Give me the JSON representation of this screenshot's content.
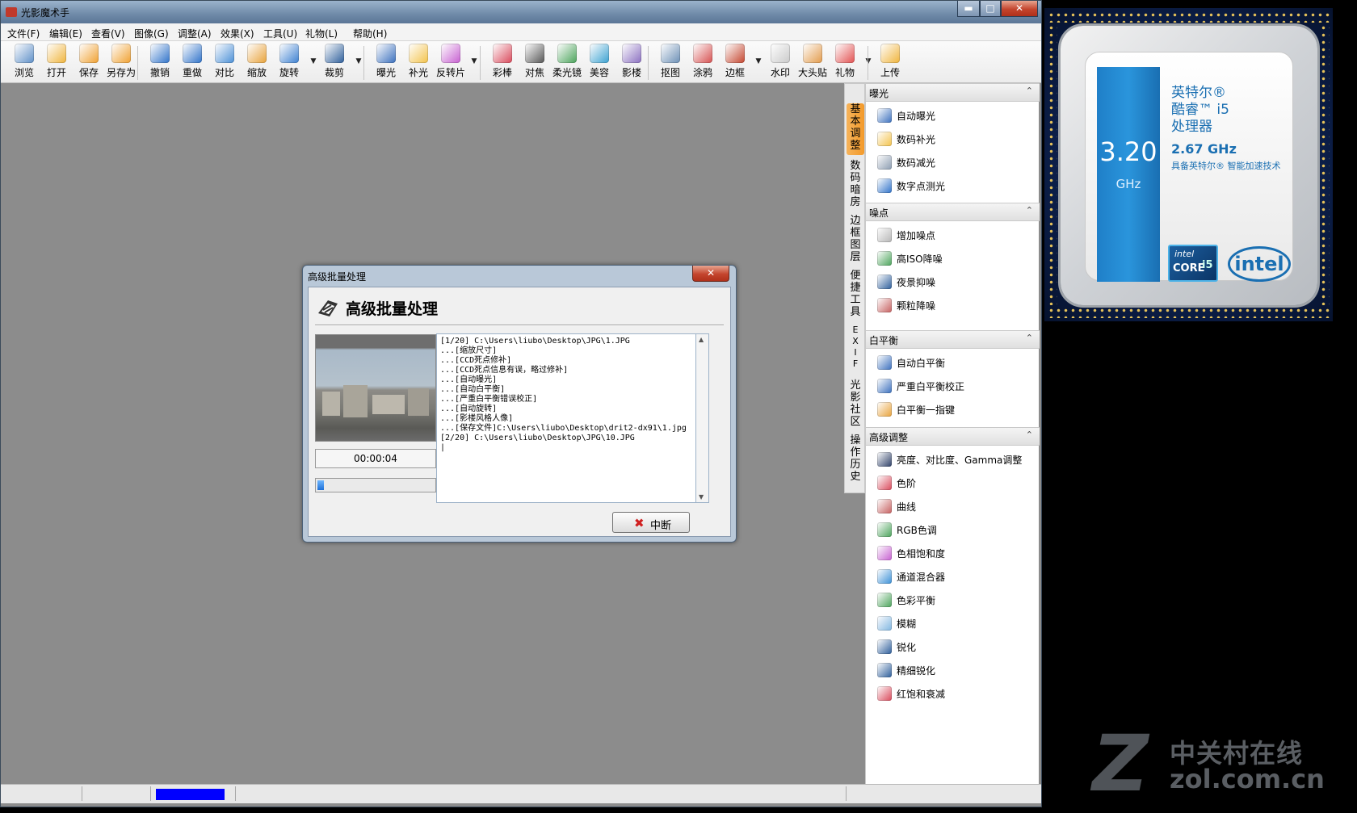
{
  "window": {
    "title": "光影魔术手",
    "caption_buttons": {
      "minimize": "▬",
      "maximize": "□",
      "close": "✕"
    }
  },
  "menu": [
    "文件(F)",
    "编辑(E)",
    "查看(V)",
    "图像(G)",
    "调整(A)",
    "效果(X)",
    "工具(U)",
    "礼物(L)",
    "帮助(H)"
  ],
  "toolbar": [
    {
      "label": "浏览",
      "icon": "browse-icon",
      "color": "#5d8fc7"
    },
    {
      "label": "打开",
      "icon": "open-folder-icon",
      "color": "#f0b43c"
    },
    {
      "label": "保存",
      "icon": "save-icon",
      "color": "#f0a030"
    },
    {
      "label": "另存为",
      "icon": "save-as-icon",
      "color": "#f0a030"
    },
    {
      "label": "撤销",
      "icon": "undo-icon",
      "color": "#2f72c9"
    },
    {
      "label": "重做",
      "icon": "redo-icon",
      "color": "#2f72c9"
    },
    {
      "label": "对比",
      "icon": "compare-icon",
      "color": "#4a8fd6"
    },
    {
      "label": "缩放",
      "icon": "zoom-icon",
      "color": "#e8a23a"
    },
    {
      "label": "旋转",
      "icon": "rotate-icon",
      "color": "#3b7fd0"
    },
    {
      "label": "裁剪",
      "icon": "crop-icon",
      "color": "#2c5d9a"
    },
    {
      "label": "曝光",
      "icon": "exposure-icon",
      "color": "#3a6fbd"
    },
    {
      "label": "补光",
      "icon": "fill-light-icon",
      "color": "#f3c24a"
    },
    {
      "label": "反转片",
      "icon": "slide-film-icon",
      "color": "#c65fd0"
    },
    {
      "label": "彩棒",
      "icon": "color-wand-icon",
      "color": "#d9485a"
    },
    {
      "label": "对焦",
      "icon": "focus-icon",
      "color": "#555555"
    },
    {
      "label": "柔光镜",
      "icon": "soft-filter-icon",
      "color": "#4aa35a"
    },
    {
      "label": "美容",
      "icon": "beauty-icon",
      "color": "#3aa0d0"
    },
    {
      "label": "影楼",
      "icon": "studio-icon",
      "color": "#8a6fc0"
    },
    {
      "label": "抠图",
      "icon": "cutout-icon",
      "color": "#6b8fb5"
    },
    {
      "label": "涂鸦",
      "icon": "doodle-icon",
      "color": "#d65050"
    },
    {
      "label": "边框",
      "icon": "frame-icon",
      "color": "#c4452e"
    },
    {
      "label": "水印",
      "icon": "watermark-icon",
      "color": "#c9c9c9"
    },
    {
      "label": "大头贴",
      "icon": "photo-sticker-icon",
      "color": "#e29a4a"
    },
    {
      "label": "礼物",
      "icon": "gift-icon",
      "color": "#e25050"
    },
    {
      "label": "上传",
      "icon": "upload-icon",
      "color": "#f0b43c"
    }
  ],
  "vtabs": [
    "基本调整",
    "数码暗房",
    "边框图层",
    "便捷工具",
    "EXIF",
    "光影社区",
    "操作历史"
  ],
  "panel": {
    "sections": [
      {
        "title": "曝光",
        "items": [
          {
            "label": "自动曝光",
            "color": "#3a6fbd"
          },
          {
            "label": "数码补光",
            "color": "#f3c24a"
          },
          {
            "label": "数码减光",
            "color": "#8a9bb0"
          },
          {
            "label": "数字点测光",
            "color": "#2f72c9"
          }
        ]
      },
      {
        "title": "噪点",
        "items": [
          {
            "label": "增加噪点",
            "color": "#b5b5b5"
          },
          {
            "label": "高ISO降噪",
            "color": "#4aa35a"
          },
          {
            "label": "夜景抑噪",
            "color": "#2c5d9a"
          },
          {
            "label": "颗粒降噪",
            "color": "#c65f5f"
          }
        ]
      },
      {
        "title": "白平衡",
        "items": [
          {
            "label": "自动白平衡",
            "color": "#3a6fbd"
          },
          {
            "label": "严重白平衡校正",
            "color": "#3a6fbd"
          },
          {
            "label": "白平衡一指键",
            "color": "#e8a23a"
          }
        ]
      },
      {
        "title": "高级调整",
        "items": [
          {
            "label": "亮度、对比度、Gamma调整",
            "color": "#2c3e66"
          },
          {
            "label": "色阶",
            "color": "#d9485a"
          },
          {
            "label": "曲线",
            "color": "#c65f5f"
          },
          {
            "label": "RGB色调",
            "color": "#4aa35a"
          },
          {
            "label": "色相饱和度",
            "color": "#c65fd0"
          },
          {
            "label": "通道混合器",
            "color": "#3a8fd6"
          },
          {
            "label": "色彩平衡",
            "color": "#4aa35a"
          },
          {
            "label": "模糊",
            "color": "#7fb5e0"
          },
          {
            "label": "锐化",
            "color": "#2c5d9a"
          },
          {
            "label": "精细锐化",
            "color": "#2c5d9a"
          },
          {
            "label": "红饱和衰减",
            "color": "#d9485a"
          }
        ]
      }
    ]
  },
  "dialog": {
    "title": "高级批量处理",
    "heading": "高级批量处理",
    "elapsed": "00:00:04",
    "progress": 0.05,
    "log_lines": [
      "[1/20] C:\\Users\\liubo\\Desktop\\JPG\\1.JPG",
      "...[缩放尺寸]",
      "...[CCD死点修补]",
      "...[CCD死点信息有误，略过修补]",
      "...[自动曝光]",
      "...[自动白平衡]",
      "...[严重白平衡错误校正]",
      "...[自动旋转]",
      "...[影楼风格人像]",
      "...[保存文件]C:\\Users\\liubo\\Desktop\\drit2-dx91\\1.jpg",
      "[2/20] C:\\Users\\liubo\\Desktop\\JPG\\10.JPG",
      "|"
    ],
    "stop_label": "中断",
    "close_glyph": "✕"
  },
  "cpu": {
    "brand_lines": [
      "英特尔®",
      "酷睿™ i5",
      "处理器"
    ],
    "freq_big": "3.20",
    "freq_unit": "GHz",
    "base_freq": "2.67 GHz",
    "turbo_text": "具备英特尔® 智能加速技术",
    "badge_top": "intel",
    "badge_core": "CORE",
    "badge_model": "i5",
    "logo": "intel"
  },
  "watermark": {
    "letter": "Z",
    "cn": "中关村在线",
    "url": "zol.com.cn"
  }
}
